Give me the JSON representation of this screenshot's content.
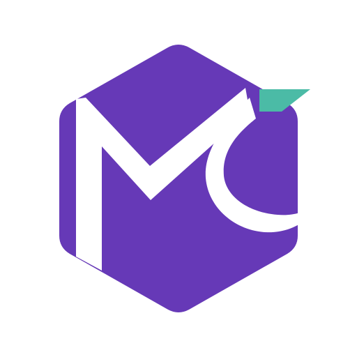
{
  "logo": {
    "name": "mc-hexagon-logo",
    "colors": {
      "background": "#ffffff",
      "hexagon": "#6639b7",
      "letters": "#ffffff",
      "accent": "#4bbba6"
    },
    "icons": {
      "mark": "hexagon-mc-monogram-icon",
      "accent": "teal-flag-icon"
    }
  }
}
